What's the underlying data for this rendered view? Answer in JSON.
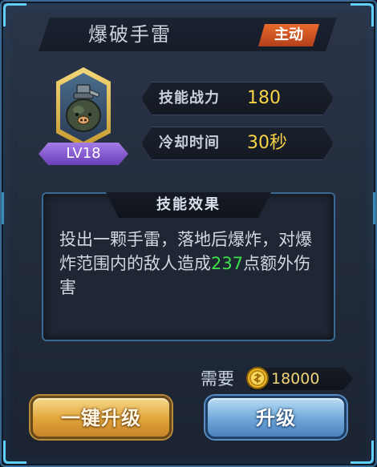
{
  "header": {
    "title": "爆破手雷",
    "type_badge": "主动"
  },
  "skill": {
    "icon": "grenade-icon",
    "level": "LV18"
  },
  "stats": [
    {
      "label": "技能战力",
      "value": "180"
    },
    {
      "label": "冷却时间",
      "value": "30秒"
    }
  ],
  "effect": {
    "title": "技能效果",
    "desc_part1": "投出一颗手雷，落地后爆炸，对爆炸范围内的敌人造成",
    "damage": "237",
    "desc_part2": "点额外伤害"
  },
  "cost": {
    "label": "需要",
    "icon": "gold-coin-icon",
    "amount": "18000"
  },
  "buttons": {
    "one_key_upgrade": "一键升级",
    "upgrade": "升级"
  },
  "colors": {
    "value_yellow": "#f6d347",
    "damage_green": "#3ee24a",
    "badge_orange": "#e86a2c",
    "level_purple": "#8a5ed0",
    "frame_blue": "#3a6a94"
  }
}
